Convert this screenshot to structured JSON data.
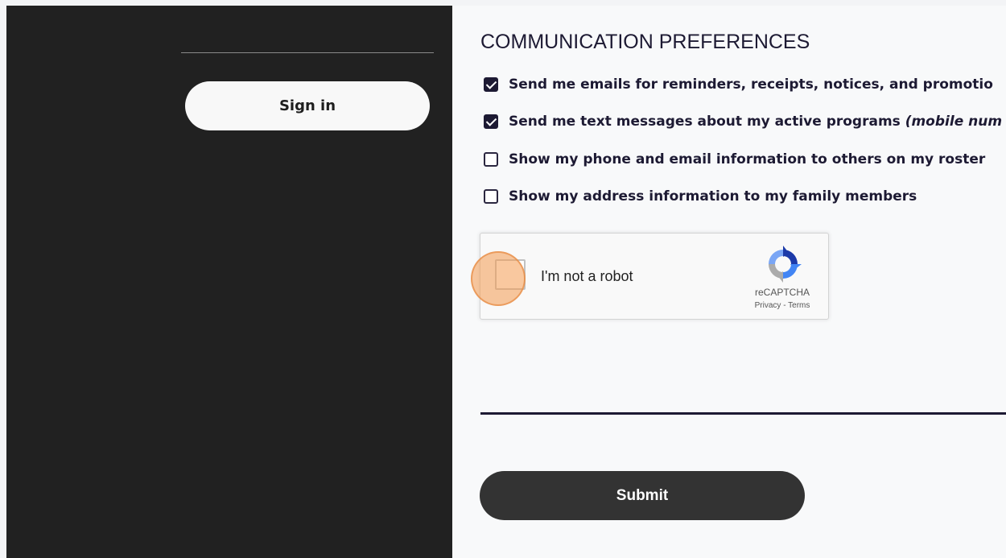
{
  "left_panel": {
    "signin_label": "Sign in"
  },
  "communication": {
    "title": "COMMUNICATION PREFERENCES",
    "options": [
      {
        "label": "Send me emails for reminders, receipts, notices, and promotio",
        "checked": true
      },
      {
        "label": "Send me text messages about my active programs ",
        "label_italic": "(mobile num",
        "checked": true
      },
      {
        "label": "Show my phone and email information to others on my roster",
        "checked": false
      },
      {
        "label": "Show my address information to my family members",
        "checked": false
      }
    ]
  },
  "recaptcha": {
    "label": "I'm not a robot",
    "brand": "reCAPTCHA",
    "privacy": "Privacy",
    "separator": " - ",
    "terms": "Terms",
    "checked": false
  },
  "form": {
    "submit_label": "Submit"
  },
  "colors": {
    "left_panel_bg": "#212121",
    "right_panel_bg": "#f8f9fa",
    "accent": "#1d1a33",
    "submit_bg": "#333333",
    "highlight": "#f49b50"
  }
}
